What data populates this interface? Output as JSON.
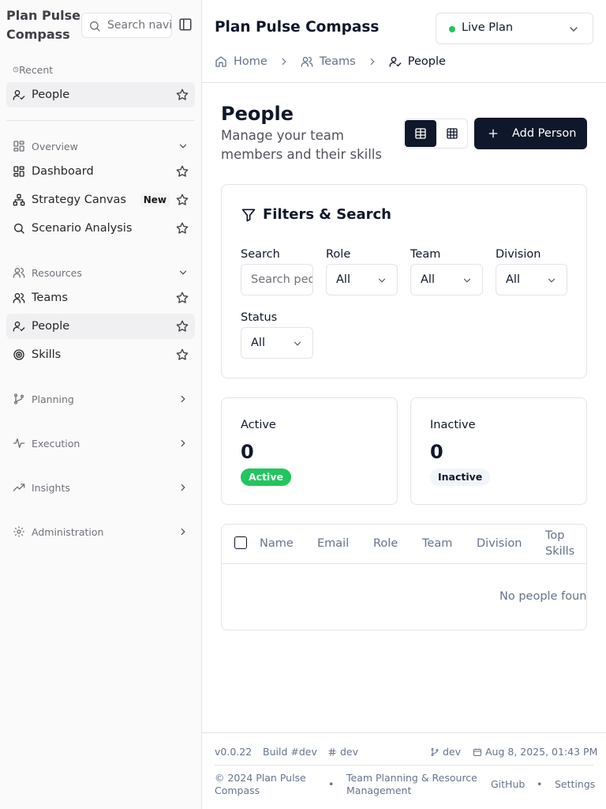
{
  "sidebar": {
    "brand": "Plan Pulse Compass",
    "search_placeholder": "Search navigation...",
    "recent_label": "Recent",
    "recent_items": [
      {
        "label": "People"
      }
    ],
    "sections": {
      "overview": {
        "label": "Overview",
        "items": [
          {
            "label": "Dashboard"
          },
          {
            "label": "Strategy Canvas",
            "badge": "New"
          },
          {
            "label": "Scenario Analysis"
          }
        ]
      },
      "resources": {
        "label": "Resources",
        "items": [
          {
            "label": "Teams"
          },
          {
            "label": "People"
          },
          {
            "label": "Skills"
          }
        ]
      },
      "planning": {
        "label": "Planning"
      },
      "execution": {
        "label": "Execution"
      },
      "insights": {
        "label": "Insights"
      },
      "administration": {
        "label": "Administration"
      }
    }
  },
  "header": {
    "title": "Plan Pulse Compass",
    "plan_select": "Live Plan",
    "breadcrumbs": [
      {
        "label": "Home"
      },
      {
        "label": "Teams"
      },
      {
        "label": "People"
      }
    ]
  },
  "page": {
    "title": "People",
    "subtitle": "Manage your team members and their skills",
    "add_button": "Add Person"
  },
  "filters": {
    "title": "Filters & Search",
    "search": {
      "label": "Search",
      "placeholder": "Search people..."
    },
    "role": {
      "label": "Role",
      "value": "All"
    },
    "team": {
      "label": "Team",
      "value": "All"
    },
    "division": {
      "label": "Division",
      "value": "All"
    },
    "status": {
      "label": "Status",
      "value": "All"
    }
  },
  "stats": {
    "active": {
      "label": "Active",
      "count": "0",
      "badge": "Active"
    },
    "inactive": {
      "label": "Inactive",
      "count": "0",
      "badge": "Inactive"
    }
  },
  "table": {
    "columns": [
      "Name",
      "Email",
      "Role",
      "Team",
      "Division",
      "Top",
      "Skills"
    ],
    "empty_message": "No people found"
  },
  "footer": {
    "version": "v0.0.22",
    "build": "Build #dev",
    "commit": "dev",
    "branch": "dev",
    "date": "Aug 8, 2025, 01:43 PM",
    "copyright": "© 2024 Plan Pulse Compass",
    "tagline": "Team Planning & Resource Management",
    "github": "GitHub",
    "settings": "Settings",
    "bullet": "•"
  },
  "colors": {
    "accent": "#0f172a",
    "active_green": "#22c55e",
    "border": "#e4e4e7"
  }
}
